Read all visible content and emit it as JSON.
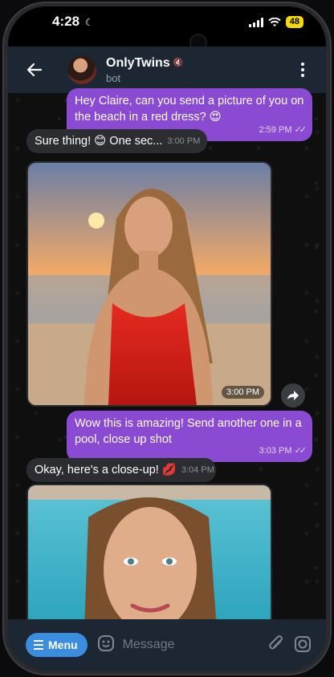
{
  "status_bar": {
    "time": "4:28",
    "battery": "48"
  },
  "header": {
    "name": "OnlyTwins",
    "subtitle": "bot"
  },
  "messages": [
    {
      "direction": "out",
      "text": "Hey Claire, can you send a picture of you on the beach in a red dress? 😍",
      "time": "2:59 PM",
      "read": true
    },
    {
      "direction": "in",
      "text": "Sure thing! 😊 One sec...",
      "time": "3:00 PM"
    },
    {
      "direction": "in",
      "type": "photo",
      "description": "beach-sunset-red-dress",
      "time": "3:00 PM"
    },
    {
      "direction": "out",
      "text": "Wow this is amazing! Send another one in a pool, close up shot",
      "time": "3:03 PM",
      "read": true
    },
    {
      "direction": "in",
      "text": "Okay, here's a close-up! 💋",
      "time": "3:04 PM"
    },
    {
      "direction": "in",
      "type": "photo",
      "description": "pool-closeup"
    }
  ],
  "input": {
    "menu_label": "Menu",
    "placeholder": "Message"
  },
  "colors": {
    "outgoing": "#8a4ad1",
    "incoming": "#2b2d31",
    "menu": "#3b8de0",
    "header": "#1c2733"
  },
  "icons": [
    "back-arrow-icon",
    "mute-icon",
    "more-vert-icon",
    "forward-icon",
    "burger-icon",
    "sticker-icon",
    "attach-icon",
    "camera-icon"
  ]
}
